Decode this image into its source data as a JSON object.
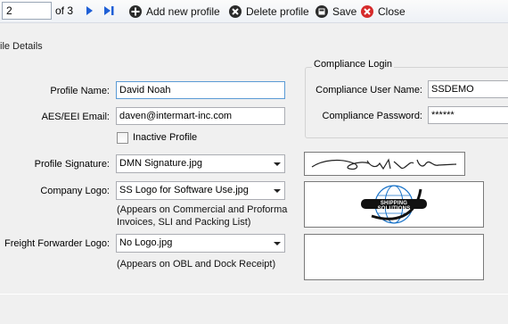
{
  "toolbar": {
    "page_current": "2",
    "page_total": "of 3",
    "add_label": "Add new profile",
    "delete_label": "Delete profile",
    "save_label": "Save",
    "close_label": "Close"
  },
  "group_title": "ile Details",
  "profile": {
    "name_label": "Profile Name:",
    "name_value": "David Noah",
    "email_label": "AES/EEI Email:",
    "email_value": "daven@intermart-inc.com",
    "inactive_label": "Inactive Profile",
    "inactive_checked": false,
    "signature_label": "Profile Signature:",
    "signature_value": "DMN Signature.jpg",
    "company_logo_label": "Company Logo:",
    "company_logo_value": "SS Logo for Software Use.jpg",
    "company_logo_note": "(Appears on Commercial and Proforma Invoices, SLI and Packing List)",
    "ff_logo_label": "Freight Forwarder Logo:",
    "ff_logo_value": "No Logo.jpg",
    "ff_logo_note": "(Appears on OBL and Dock Receipt)"
  },
  "compliance": {
    "title": "Compliance Login",
    "user_label": "Compliance User Name:",
    "user_value": "SSDEMO",
    "password_label": "Compliance Password:",
    "password_value": "******"
  },
  "images": {
    "logo_text": "SHIPPING SOLUTIONS"
  },
  "colors": {
    "nav_blue": "#1f5fd6",
    "delete_dark": "#2b2b2b",
    "close_red": "#d62b2b",
    "focus_border": "#5b9bd5"
  }
}
